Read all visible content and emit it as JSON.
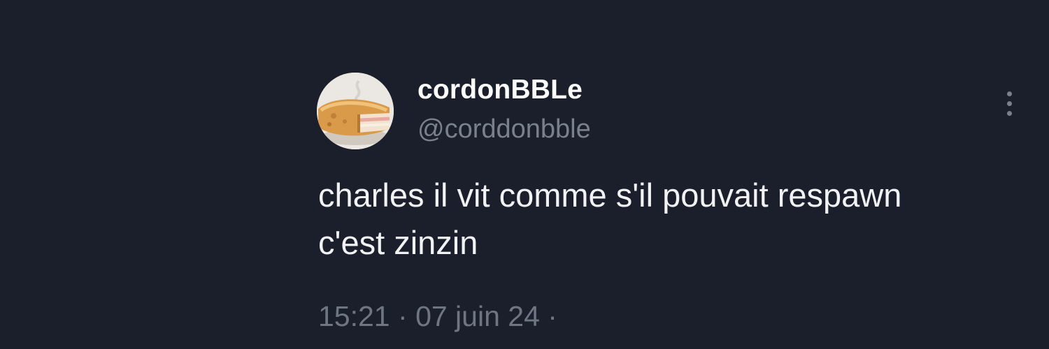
{
  "author": {
    "display_name": "cordonBBLe",
    "handle": "@corddonbble"
  },
  "tweet": {
    "text": "charles il vit comme s'il pouvait respawn c'est zinzin",
    "time": "15:21",
    "date": "07 juin 24",
    "separator": "·"
  },
  "icons": {
    "more": "more-vertical-icon",
    "avatar": "cordon-bleu-avatar-image"
  },
  "colors": {
    "background": "#1b1f2b",
    "primary_text": "#ffffff",
    "secondary_text": "#7a818d"
  }
}
